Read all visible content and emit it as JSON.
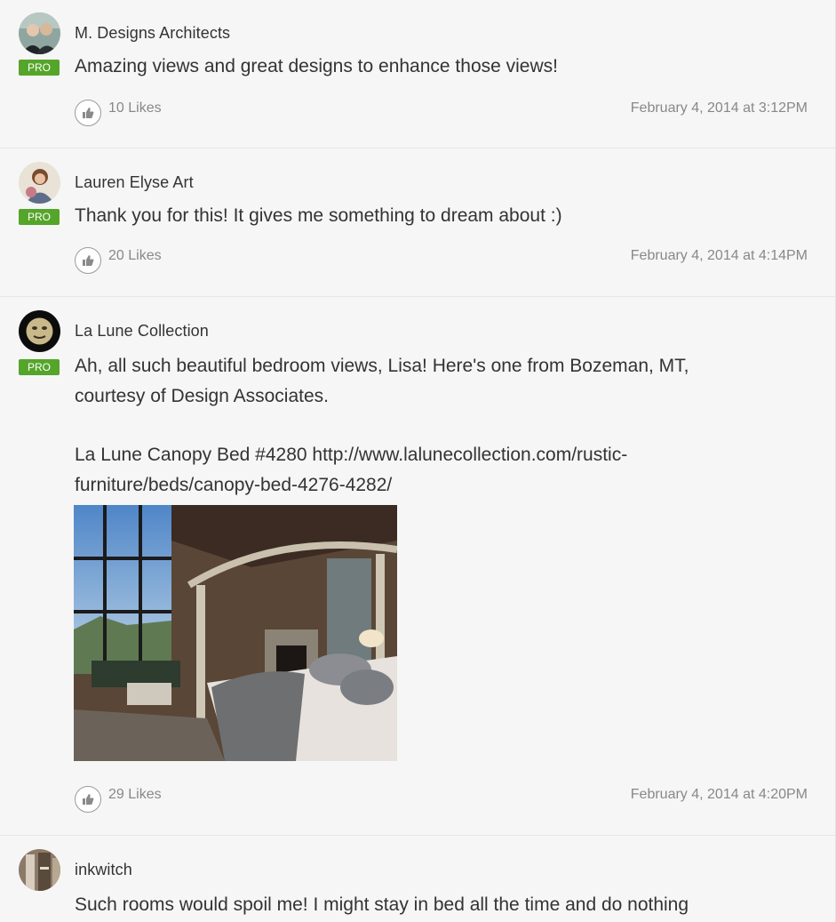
{
  "comments": [
    {
      "author": "M. Designs Architects",
      "badge": "PRO",
      "text": "Amazing views and great designs to enhance those views!",
      "likes": "10 Likes",
      "date": "February 4, 2014 at 3:12PM"
    },
    {
      "author": "Lauren Elyse Art",
      "badge": "PRO",
      "text": "Thank you for this! It gives me something to dream about :)",
      "likes": "20 Likes",
      "date": "February 4, 2014 at 4:14PM"
    },
    {
      "author": "La Lune Collection",
      "badge": "PRO",
      "text_line1": "Ah, all such beautiful bedroom views, Lisa! Here's one from Bozeman, MT,",
      "text_line2": "courtesy of Design Associates.",
      "link_line1": "La Lune Canopy Bed #4280 http://www.lalunecollection.com/rustic-",
      "link_line2": "furniture/beds/canopy-bed-4276-4282/",
      "likes": "29 Likes",
      "date": "February 4, 2014 at 4:20PM"
    },
    {
      "author": "inkwitch",
      "text": "Such rooms would spoil me! I might stay in bed all the time and do nothing"
    }
  ],
  "colors": {
    "pro_badge": "#55a52a",
    "meta_text": "#888888"
  },
  "icons": {
    "like": "thumbs-up-icon"
  }
}
